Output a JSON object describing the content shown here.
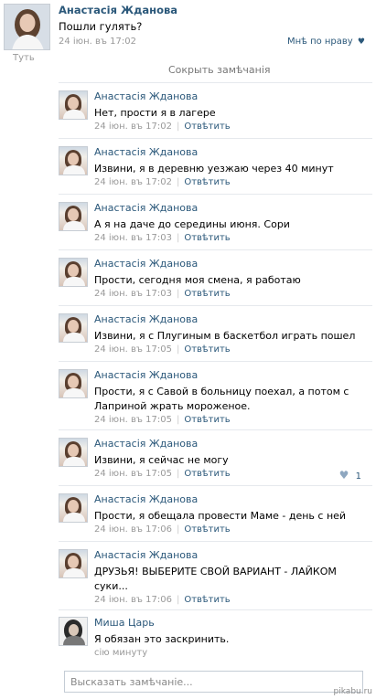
{
  "post": {
    "author": "Анастасія Жданова",
    "text": "Пошли гулять?",
    "time": "24 іюн. въ 17:02",
    "like_label": "Мнѣ по нраву",
    "like_icon": "heart-icon",
    "tut": "Туть"
  },
  "hide_comments_label": "Сокрыть замѣчанія",
  "comments": [
    {
      "author": "Анастасія Жданова",
      "text": "Нет, прости я в лагере",
      "time": "24 іюн. въ 17:02",
      "reply": "Отвѣтить"
    },
    {
      "author": "Анастасія Жданова",
      "text": "Извини, я в деревню уезжаю через 40 минут",
      "time": "24 іюн. въ 17:02",
      "reply": "Отвѣтить"
    },
    {
      "author": "Анастасія Жданова",
      "text": "А я на даче до середины июня. Сори",
      "time": "24 іюн. въ 17:03",
      "reply": "Отвѣтить"
    },
    {
      "author": "Анастасія Жданова",
      "text": "Прости, сегодня моя смена, я работаю",
      "time": "24 іюн. въ 17:03",
      "reply": "Отвѣтить"
    },
    {
      "author": "Анастасія Жданова",
      "text": "Извини, я с Плугиным в баскетбол играть пошел",
      "time": "24 іюн. въ 17:05",
      "reply": "Отвѣтить"
    },
    {
      "author": "Анастасія Жданова",
      "text": "Прости, я с Савой в больницу поехал, а потом с Лаприной жрать мороженое.",
      "time": "24 іюн. въ 17:05",
      "reply": "Отвѣтить"
    },
    {
      "author": "Анастасія Жданова",
      "text": "Извини, я сейчас не могу",
      "time": "24 іюн. въ 17:05",
      "reply": "Отвѣтить",
      "likes": "1",
      "like_icon": "heart-icon"
    },
    {
      "author": "Анастасія Жданова",
      "text": "Прости, я обещала провести Маме - день с ней",
      "time": "24 іюн. въ 17:06",
      "reply": "Отвѣтить"
    },
    {
      "author": "Анастасія Жданова",
      "text": "ДРУЗЬЯ! ВЫБЕРИТЕ СВОЙ ВАРИАНТ - ЛАЙКОМ суки...",
      "time": "24 іюн. въ 17:06",
      "reply": "Отвѣтить"
    },
    {
      "author": "Миша Царь",
      "text": "Я обязан это заскринить.",
      "time": "сію минуту"
    }
  ],
  "comment_input": {
    "placeholder": "Высказать замѣчаніе...",
    "value": ""
  },
  "watermark": "pikabu.ru"
}
